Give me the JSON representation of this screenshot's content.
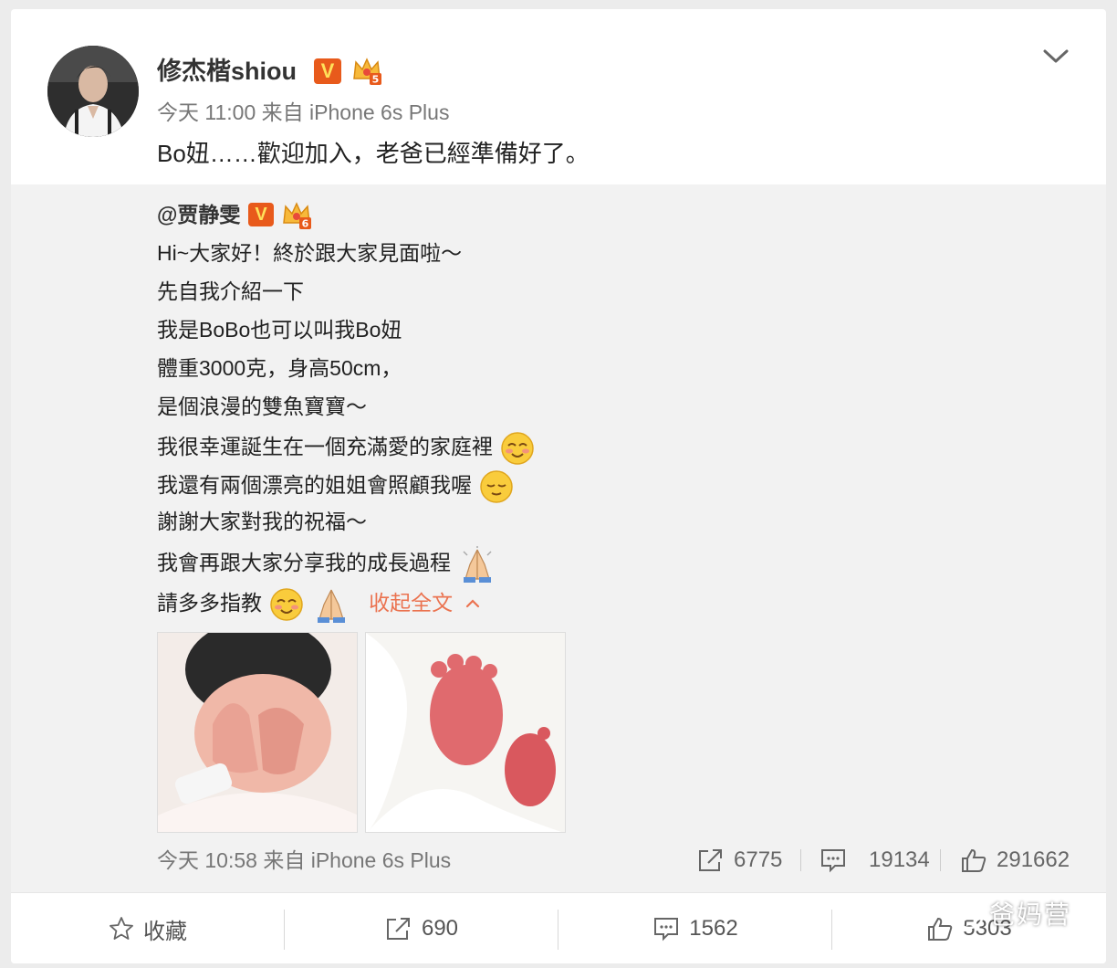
{
  "post": {
    "author": "修杰楷shiou",
    "time": "今天 11:00",
    "source": "来自 iPhone 6s Plus",
    "text": "Bo妞……歡迎加入，老爸已經準備好了。"
  },
  "repost": {
    "author": "@贾静雯",
    "lines": [
      "Hi~大家好！終於跟大家見面啦～",
      "先自我介紹一下",
      "我是BoBo也可以叫我Bo妞",
      "體重3000克，身高50cm，",
      "是個浪漫的雙魚寶寶～",
      "我很幸運誕生在一個充滿愛的家庭裡",
      "我還有兩個漂亮的姐姐會照顧我喔",
      "謝謝大家對我的祝福～",
      "我會再跟大家分享我的成長過程",
      "請多多指教"
    ],
    "collapse_label": "收起全文",
    "time": "今天 10:58",
    "source": "来自 iPhone 6s Plus",
    "stats": {
      "reposts": "6775",
      "comments": "19134",
      "likes": "291662"
    }
  },
  "actions": {
    "favorite_label": "收藏",
    "repost_count": "690",
    "comment_count": "1562",
    "like_count": "5303"
  },
  "badges": {
    "verified": "V",
    "vip_level": "5",
    "vip_level_repost": "6"
  },
  "watermark": "爸妈营",
  "colors": {
    "accent_link": "#eb7350",
    "verified_bg": "#e85a1b",
    "repost_bg": "#f2f2f2"
  }
}
